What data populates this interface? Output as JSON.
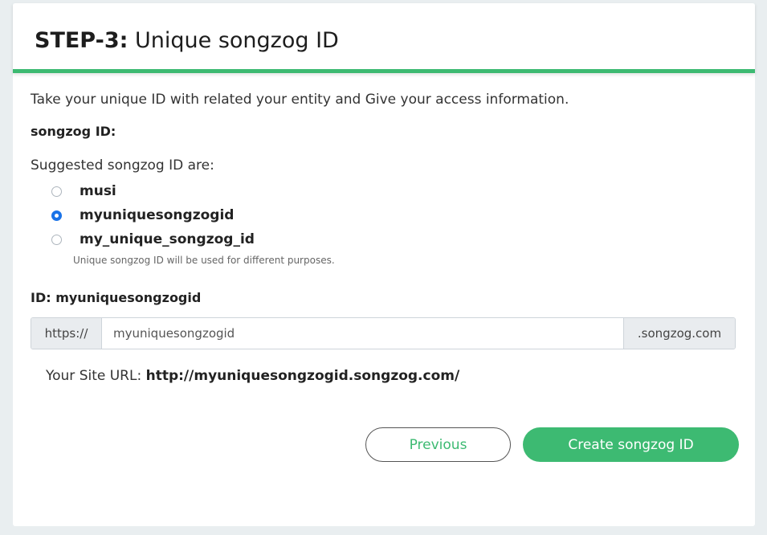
{
  "header": {
    "step": "STEP-3:",
    "title": "Unique songzog ID"
  },
  "intro": "Take your unique ID with related your entity and Give your access information.",
  "songzog_label": "songzog ID:",
  "suggested_label": "Suggested songzog ID are:",
  "options": [
    {
      "label": "musi",
      "checked": false
    },
    {
      "label": "myuniquesongzogid",
      "checked": true
    },
    {
      "label": "my_unique_songzog_id",
      "checked": false
    }
  ],
  "hint": "Unique songzog ID will be used for different purposes.",
  "id_label": "ID: myuniquesongzogid",
  "input": {
    "prefix": "https://",
    "value": "myuniquesongzogid",
    "suffix": ".songzog.com"
  },
  "site_url": {
    "label": "Your Site URL:",
    "value": "http://myuniquesongzogid.songzog.com/"
  },
  "buttons": {
    "previous": "Previous",
    "create": "Create songzog ID"
  },
  "colors": {
    "accent": "#3dba72",
    "radio_checked": "#1a73e8"
  }
}
